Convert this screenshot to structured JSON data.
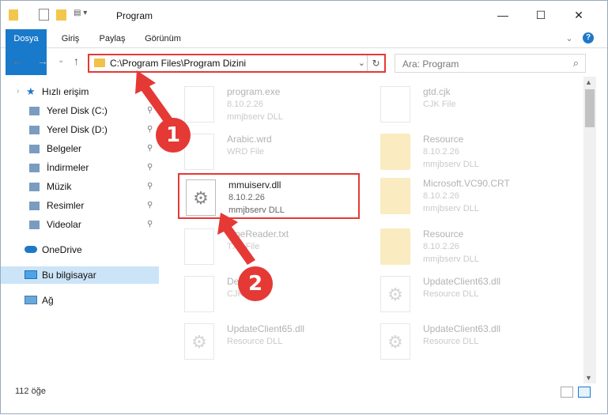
{
  "window": {
    "title": "Program",
    "minimize_glyph": "—",
    "maximize_glyph": "☐",
    "close_glyph": "✕"
  },
  "ribbon": {
    "tabs": [
      "Dosya",
      "Giriş",
      "Paylaş",
      "Görünüm"
    ],
    "expand_glyph": "⌄",
    "help_glyph": "?"
  },
  "nav": {
    "back_glyph": "←",
    "forward_glyph": "→",
    "recent_glyph": "⌄",
    "up_glyph": "↑",
    "address": "C:\\Program Files\\Program Dizini",
    "address_dd_glyph": "⌄",
    "refresh_glyph": "↻",
    "search_placeholder": "Ara: Program",
    "search_glyph": "⌕"
  },
  "sidebar": {
    "quick_access": "Hızlı erişim",
    "items": [
      {
        "label": "Yerel Disk (C:)",
        "icon": "drive-icon",
        "pinned": true
      },
      {
        "label": "Yerel Disk (D:)",
        "icon": "drive-icon",
        "pinned": true
      },
      {
        "label": "Belgeler",
        "icon": "documents-icon",
        "pinned": true
      },
      {
        "label": "İndirmeler",
        "icon": "downloads-icon",
        "pinned": true
      },
      {
        "label": "Müzik",
        "icon": "music-icon",
        "pinned": true
      },
      {
        "label": "Resimler",
        "icon": "pictures-icon",
        "pinned": true
      },
      {
        "label": "Videolar",
        "icon": "videos-icon",
        "pinned": true
      }
    ],
    "onedrive": "OneDrive",
    "this_pc": "Bu bilgisayar",
    "network": "Ağ",
    "pin_glyph": "📌"
  },
  "files": [
    {
      "name": "program.exe",
      "version": "8.10.2.26",
      "type": "mmjbserv DLL",
      "kind": "exe",
      "faded": true
    },
    {
      "name": "gtd.cjk",
      "version": "CJK File",
      "type": "",
      "kind": "doc",
      "faded": true
    },
    {
      "name": "Arabic.wrd",
      "version": "WRD File",
      "type": "",
      "kind": "doc",
      "faded": true
    },
    {
      "name": "Resource",
      "version": "8.10.2.26",
      "type": "mmjbserv DLL",
      "kind": "folder",
      "faded": true
    },
    {
      "name": "mmuiserv.dll",
      "version": "8.10.2.26",
      "type": "mmjbserv DLL",
      "kind": "dll",
      "faded": false
    },
    {
      "name": "Microsoft.VC90.CRT",
      "version": "8.10.2.26",
      "type": "mmjbserv DLL",
      "kind": "folder",
      "faded": true
    },
    {
      "name": "FineReader.txt",
      "version": "TXT File",
      "type": "",
      "kind": "doc",
      "faded": true
    },
    {
      "name": "Resource",
      "version": "8.10.2.26",
      "type": "mmjbserv DLL",
      "kind": "folder",
      "faded": true
    },
    {
      "name": "Default.cjk",
      "version": "CJK File",
      "type": "",
      "kind": "doc",
      "faded": true
    },
    {
      "name": "UpdateClient63.dll",
      "version": "Resource DLL",
      "type": "",
      "kind": "dll",
      "faded": true
    },
    {
      "name": "UpdateClient65.dll",
      "version": "Resource DLL",
      "type": "",
      "kind": "dll",
      "faded": true
    },
    {
      "name": "UpdateClient63.dll",
      "version": "Resource DLL",
      "type": "",
      "kind": "dll",
      "faded": true
    }
  ],
  "status": {
    "count": "112 öğe"
  },
  "annotations": {
    "step1": "1",
    "step2": "2"
  },
  "colors": {
    "accent": "#1979ca",
    "highlight": "#e53935",
    "folder": "#f2c74c",
    "selected": "#cce4f7"
  }
}
